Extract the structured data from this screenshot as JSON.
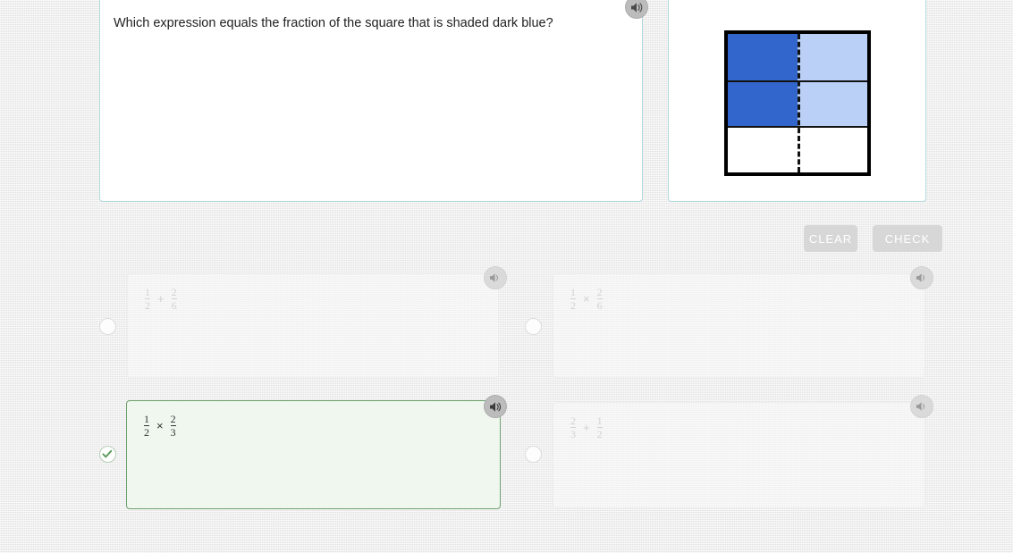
{
  "question": {
    "text": "Which expression equals the fraction of the square that is shaded dark blue?",
    "audio_icon": "speaker-icon"
  },
  "figure": {
    "name": "shaded-square-diagram",
    "rows": 3,
    "columns": 2,
    "colors": {
      "dark_blue": "#3366cc",
      "light_blue": "#bad0f7",
      "empty": "#ffffff",
      "outline": "#000000"
    },
    "cells": [
      [
        "dark",
        "light"
      ],
      [
        "dark",
        "light"
      ],
      [
        "empty",
        "empty"
      ]
    ],
    "vertical_divider": "dashed",
    "horizontal_divider": "solid"
  },
  "toolbar": {
    "clear_label": "CLEAR",
    "check_label": "CHECK"
  },
  "options": [
    {
      "id": "a",
      "state": "unselected",
      "indicator": "radio-empty",
      "audio_icon": "speaker-icon",
      "expression": {
        "left": {
          "numerator": "1",
          "denominator": "2"
        },
        "operator": "+",
        "right": {
          "numerator": "2",
          "denominator": "6"
        }
      }
    },
    {
      "id": "b",
      "state": "unselected",
      "indicator": "radio-empty",
      "audio_icon": "speaker-icon",
      "expression": {
        "left": {
          "numerator": "1",
          "denominator": "2"
        },
        "operator": "×",
        "right": {
          "numerator": "2",
          "denominator": "6"
        }
      }
    },
    {
      "id": "c",
      "state": "selected-correct",
      "indicator": "check-mark",
      "audio_icon": "speaker-icon",
      "expression": {
        "left": {
          "numerator": "1",
          "denominator": "2"
        },
        "operator": "×",
        "right": {
          "numerator": "2",
          "denominator": "3"
        }
      }
    },
    {
      "id": "d",
      "state": "unselected",
      "indicator": "radio-empty",
      "audio_icon": "speaker-icon",
      "expression": {
        "left": {
          "numerator": "2",
          "denominator": "3"
        },
        "operator": "+",
        "right": {
          "numerator": "1",
          "denominator": "2"
        }
      }
    }
  ],
  "colors": {
    "card_border": "#b2d9de",
    "selected_border": "#6da06d",
    "selected_fill": "#eff7ef",
    "check_green": "#5a9a5a",
    "button_bg": "#d7d7d7",
    "page_bg": "#ededed"
  }
}
